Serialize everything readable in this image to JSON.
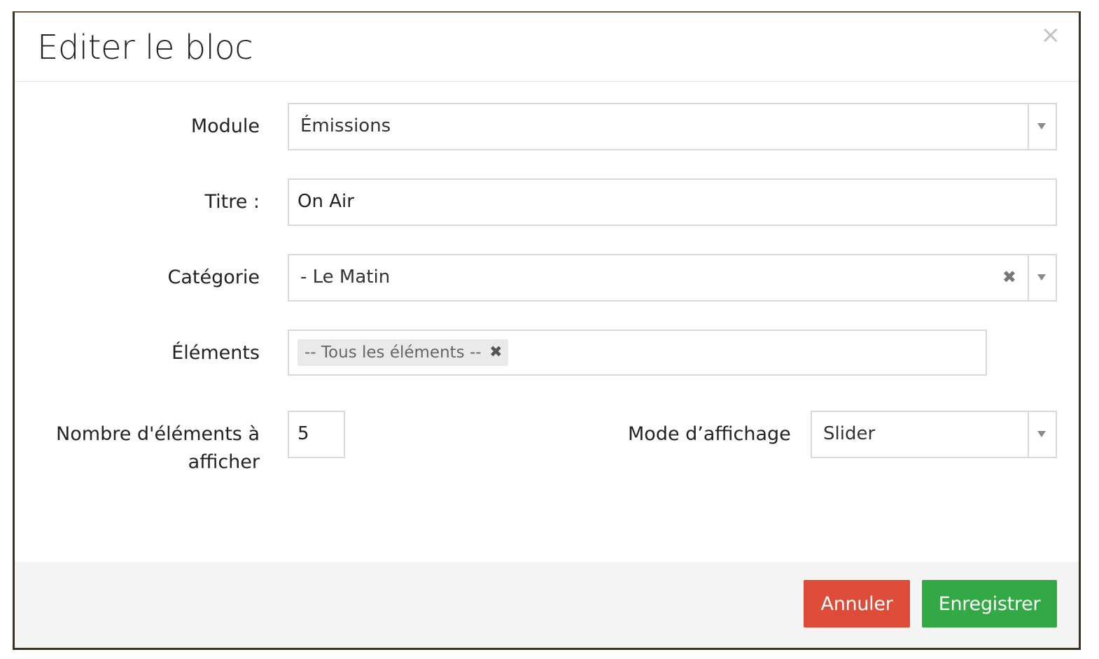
{
  "modal": {
    "title": "Editer le bloc",
    "close_glyph": "×"
  },
  "form": {
    "module": {
      "label": "Module",
      "value": "Émissions"
    },
    "titre": {
      "label": "Titre :",
      "value": "On Air"
    },
    "categorie": {
      "label": "Catégorie",
      "value": "- Le Matin",
      "clear_glyph": "✖"
    },
    "elements": {
      "label": "Éléments",
      "tags": [
        {
          "text": "-- Tous les éléments --",
          "remove_glyph": "✖"
        }
      ]
    },
    "nombre": {
      "label_line1": "Nombre d'éléments à",
      "label_line2": "afficher",
      "value": "5"
    },
    "mode": {
      "label": "Mode d’affichage",
      "value": "Slider"
    }
  },
  "footer": {
    "cancel_label": "Annuler",
    "save_label": "Enregistrer"
  },
  "colors": {
    "cancel": "#dd4b39",
    "save": "#33a946",
    "footer_bg": "#f4f4f4"
  },
  "icons": {
    "close": "close-icon",
    "select_caret": "chevron-down-icon",
    "clear": "clear-icon",
    "tag_remove": "tag-remove-icon"
  }
}
